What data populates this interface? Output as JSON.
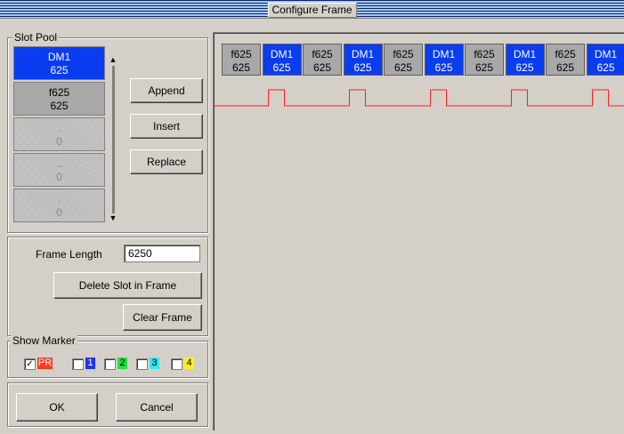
{
  "window": {
    "title": "Configure Frame"
  },
  "slot_pool": {
    "label": "Slot Pool",
    "items": [
      {
        "line1": "DM1",
        "line2": "625",
        "kind": "dm"
      },
      {
        "line1": "f625",
        "line2": "625",
        "kind": "f"
      },
      {
        "line1": ".",
        "line2": "0",
        "kind": "empty"
      },
      {
        "line1": "..",
        "line2": "0",
        "kind": "empty"
      },
      {
        "line1": ".",
        "line2": "0",
        "kind": "empty"
      }
    ],
    "append_label": "Append",
    "insert_label": "Insert",
    "replace_label": "Replace"
  },
  "frame": {
    "length_label": "Frame Length",
    "length_value": "6250",
    "delete_label": "Delete Slot in Frame",
    "clear_label": "Clear Frame",
    "cells": [
      {
        "line1": "f625",
        "line2": "625",
        "kind": "f"
      },
      {
        "line1": "DM1",
        "line2": "625",
        "kind": "dm"
      },
      {
        "line1": "f625",
        "line2": "625",
        "kind": "f"
      },
      {
        "line1": "DM1",
        "line2": "625",
        "kind": "dm"
      },
      {
        "line1": "f625",
        "line2": "625",
        "kind": "f"
      },
      {
        "line1": "DM1",
        "line2": "625",
        "kind": "dm"
      },
      {
        "line1": "f625",
        "line2": "625",
        "kind": "f"
      },
      {
        "line1": "DM1",
        "line2": "625",
        "kind": "dm"
      },
      {
        "line1": "f625",
        "line2": "625",
        "kind": "f"
      },
      {
        "line1": "DM1",
        "line2": "625",
        "kind": "dm"
      }
    ],
    "marker_color": "#ff2020"
  },
  "show_marker": {
    "label": "Show Marker",
    "items": [
      {
        "text": "PR",
        "checked": true,
        "bg": "#ff3c1e",
        "fg": "#ffffff",
        "check_mark": "✓"
      },
      {
        "text": "1",
        "checked": false,
        "bg": "#1e32ff",
        "fg": "#ffffff",
        "check_mark": ""
      },
      {
        "text": "2",
        "checked": false,
        "bg": "#20e040",
        "fg": "#000000",
        "check_mark": ""
      },
      {
        "text": "3",
        "checked": false,
        "bg": "#30e8f0",
        "fg": "#000000",
        "check_mark": ""
      },
      {
        "text": "4",
        "checked": false,
        "bg": "#fff020",
        "fg": "#000000",
        "check_mark": ""
      }
    ]
  },
  "dialog": {
    "ok_label": "OK",
    "cancel_label": "Cancel"
  }
}
